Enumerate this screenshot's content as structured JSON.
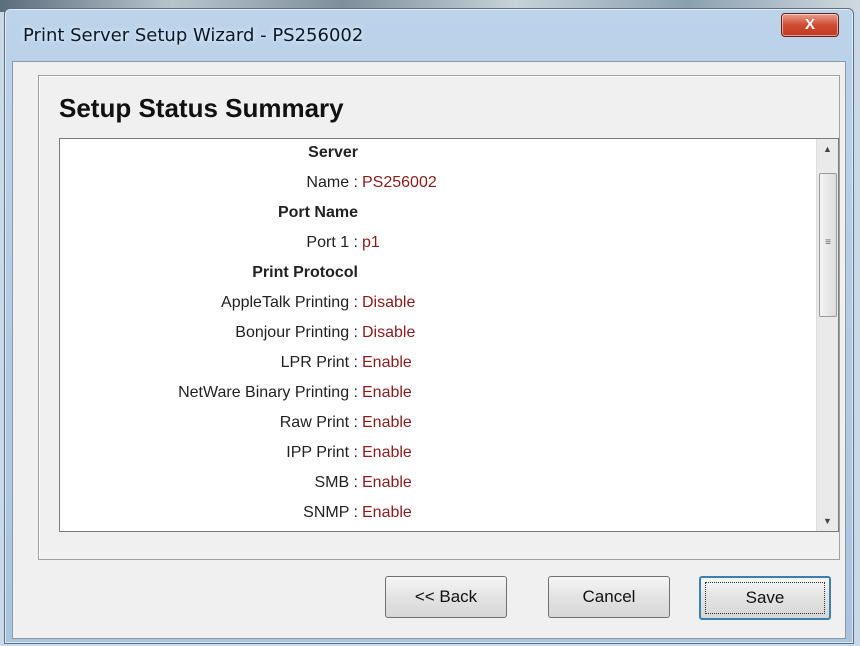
{
  "window": {
    "title": "Print Server Setup Wizard - PS256002",
    "close_label": "X"
  },
  "page": {
    "title": "Setup Status Summary"
  },
  "summary": {
    "sections": [
      {
        "heading": "Server",
        "rows": [
          {
            "label": "Name :",
            "value": "PS256002"
          }
        ]
      },
      {
        "heading": "Port Name",
        "rows": [
          {
            "label": "Port 1 :",
            "value": "p1"
          }
        ]
      },
      {
        "heading": "Print Protocol",
        "rows": [
          {
            "label": "AppleTalk Printing :",
            "value": "Disable"
          },
          {
            "label": "Bonjour Printing :",
            "value": "Disable"
          },
          {
            "label": "LPR Print :",
            "value": "Enable"
          },
          {
            "label": "NetWare Binary Printing :",
            "value": "Enable"
          },
          {
            "label": "Raw Print :",
            "value": "Enable"
          },
          {
            "label": "IPP Print :",
            "value": "Enable"
          },
          {
            "label": "SMB :",
            "value": "Enable"
          },
          {
            "label": "SNMP :",
            "value": "Enable"
          }
        ]
      }
    ]
  },
  "scrollbar": {
    "up_icon": "▲",
    "down_icon": "▼",
    "grip": "≡"
  },
  "buttons": {
    "back": "<< Back",
    "cancel": "Cancel",
    "save": "Save"
  },
  "colors": {
    "value_text": "#8b1a1a",
    "accent": "#3c7fb1"
  }
}
